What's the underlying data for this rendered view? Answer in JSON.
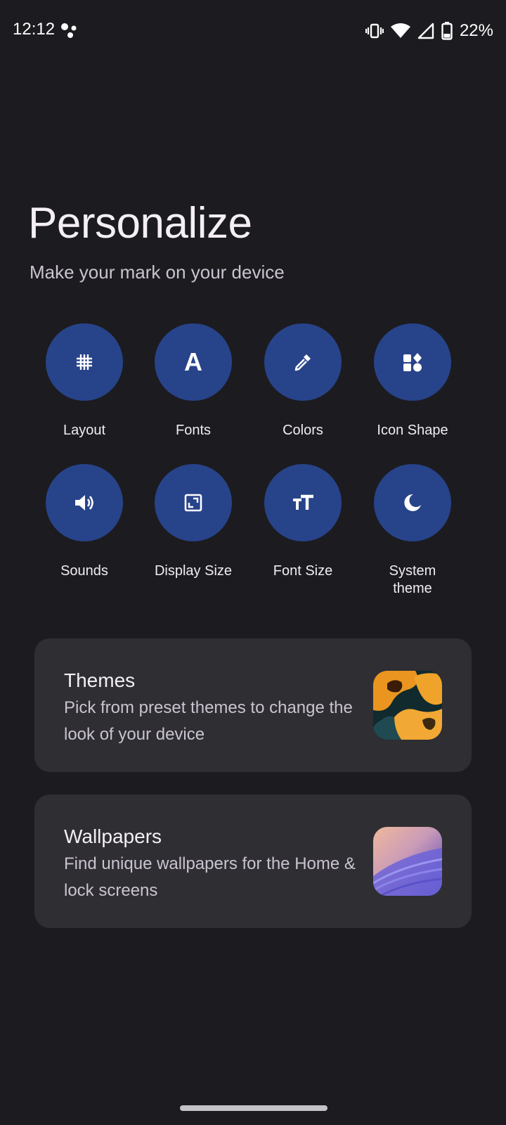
{
  "status_bar": {
    "time": "12:12",
    "battery": "22%",
    "icons": [
      "assistant-icon",
      "vibrate-icon",
      "wifi-icon",
      "signal-icon",
      "battery-icon"
    ]
  },
  "header": {
    "title": "Personalize",
    "subtitle": "Make your mark on your device"
  },
  "options": [
    {
      "label": "Layout",
      "icon": "grid-icon"
    },
    {
      "label": "Fonts",
      "icon": "font-icon",
      "glyph": "A"
    },
    {
      "label": "Colors",
      "icon": "eyedropper-icon"
    },
    {
      "label": "Icon Shape",
      "icon": "shapes-icon"
    },
    {
      "label": "Sounds",
      "icon": "volume-icon"
    },
    {
      "label": "Display Size",
      "icon": "display-size-icon"
    },
    {
      "label": "Font Size",
      "icon": "font-size-icon"
    },
    {
      "label": "System\ntheme",
      "icon": "moon-icon"
    }
  ],
  "cards": [
    {
      "title": "Themes",
      "description": "Pick from preset themes to change the look of your device",
      "thumbnail": "themes-thumbnail"
    },
    {
      "title": "Wallpapers",
      "description": "Find unique wallpapers for the Home & lock screens",
      "thumbnail": "wallpapers-thumbnail"
    }
  ],
  "colors": {
    "background": "#1c1b1f",
    "circle": "#27438a",
    "card": "#2f2e33"
  }
}
